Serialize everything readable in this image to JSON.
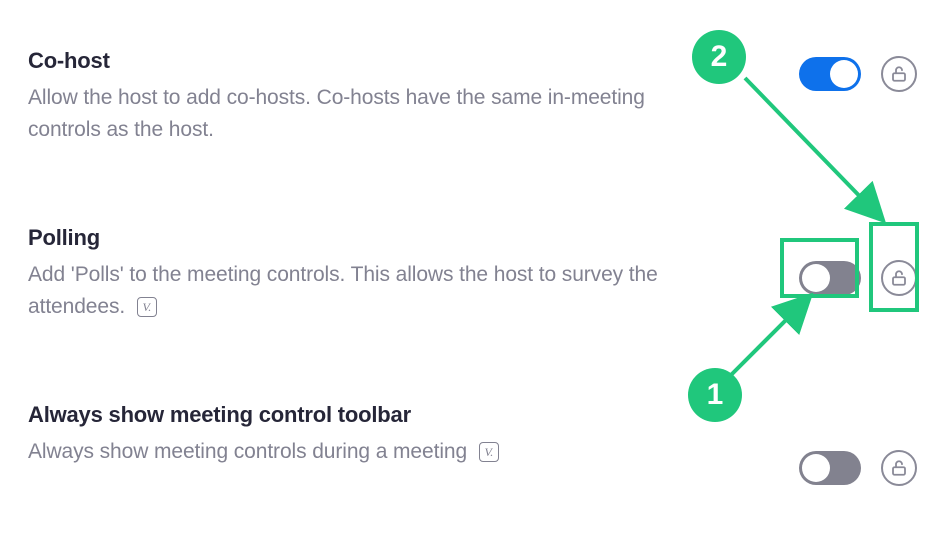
{
  "settings": [
    {
      "title": "Co-host",
      "desc": "Allow the host to add co-hosts. Co-hosts have the same in-meeting controls as the host.",
      "toggle": true,
      "version_badge": false
    },
    {
      "title": "Polling",
      "desc": "Add 'Polls' to the meeting controls. This allows the host to survey the attendees.",
      "toggle": false,
      "version_badge": true
    },
    {
      "title": "Always show meeting control toolbar",
      "desc": "Always show meeting controls during a meeting",
      "toggle": false,
      "version_badge": true
    }
  ],
  "annotations": {
    "callout1": "1",
    "callout2": "2"
  },
  "colors": {
    "accent_green": "#20c77c",
    "toggle_on": "#0E71EB",
    "toggle_off": "#82828F",
    "text_muted": "#828291"
  }
}
